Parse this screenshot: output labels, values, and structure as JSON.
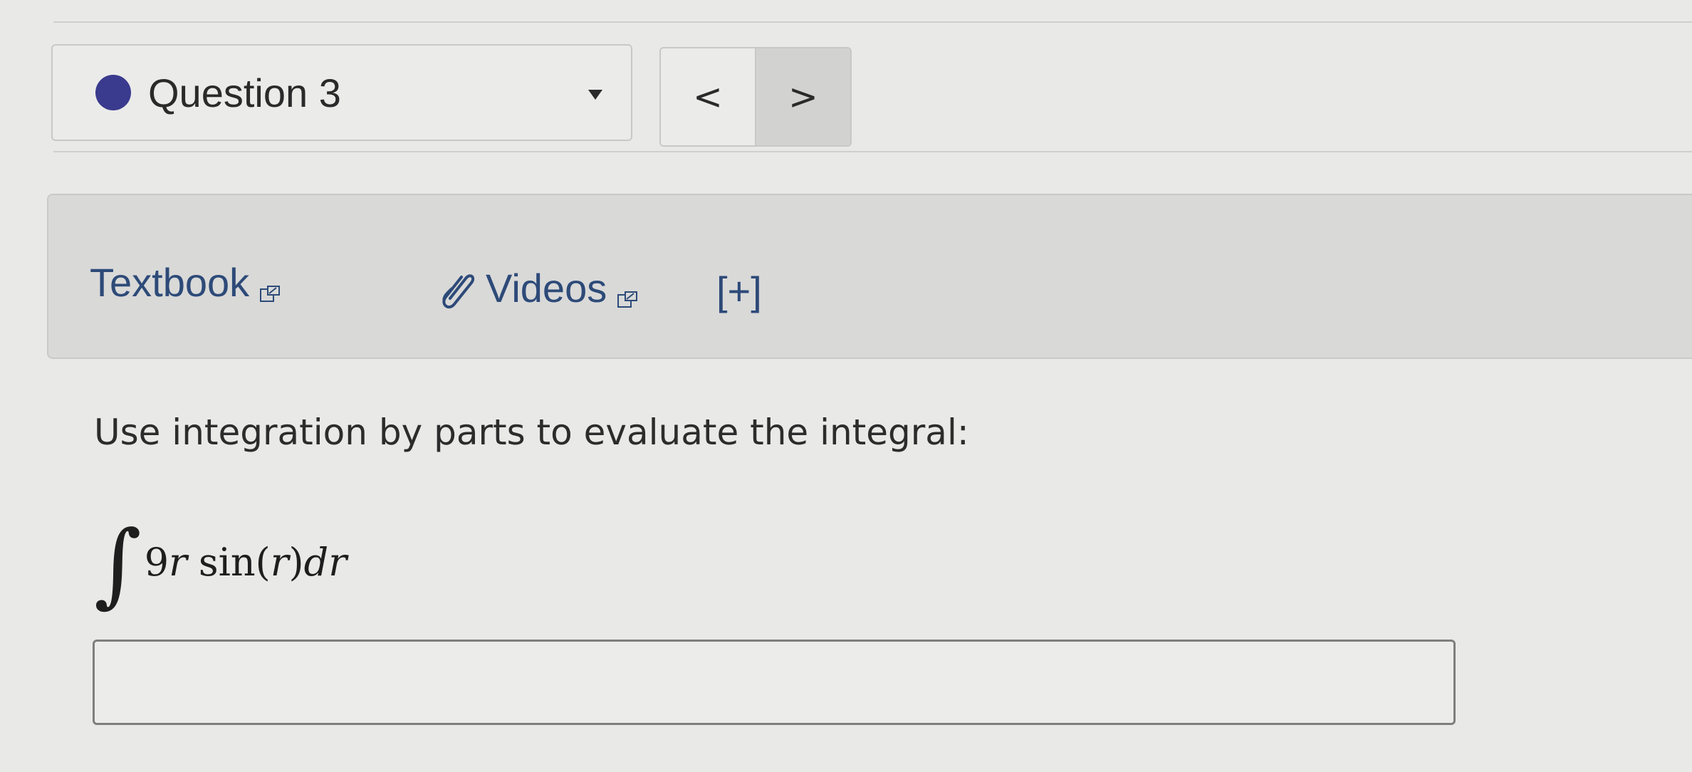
{
  "header": {
    "question_label": "Question 3",
    "status_color": "#3a3a8e",
    "prev_label": "<",
    "next_label": ">"
  },
  "resources": {
    "textbook_label": "Textbook",
    "videos_label": "Videos",
    "expand_label": "[+]",
    "link_color": "#2d4a78",
    "icons": [
      "external-link-icon",
      "paperclip-icon"
    ]
  },
  "question": {
    "prompt": "Use integration by parts to evaluate the integral:",
    "integral_sign": "∫",
    "integrand_coefficient": "9",
    "integrand_var": "r",
    "function_name": "sin",
    "open_paren": "(",
    "argument": "r",
    "close_paren": ")",
    "differential": "dr"
  },
  "answer": {
    "value": "",
    "placeholder": ""
  }
}
